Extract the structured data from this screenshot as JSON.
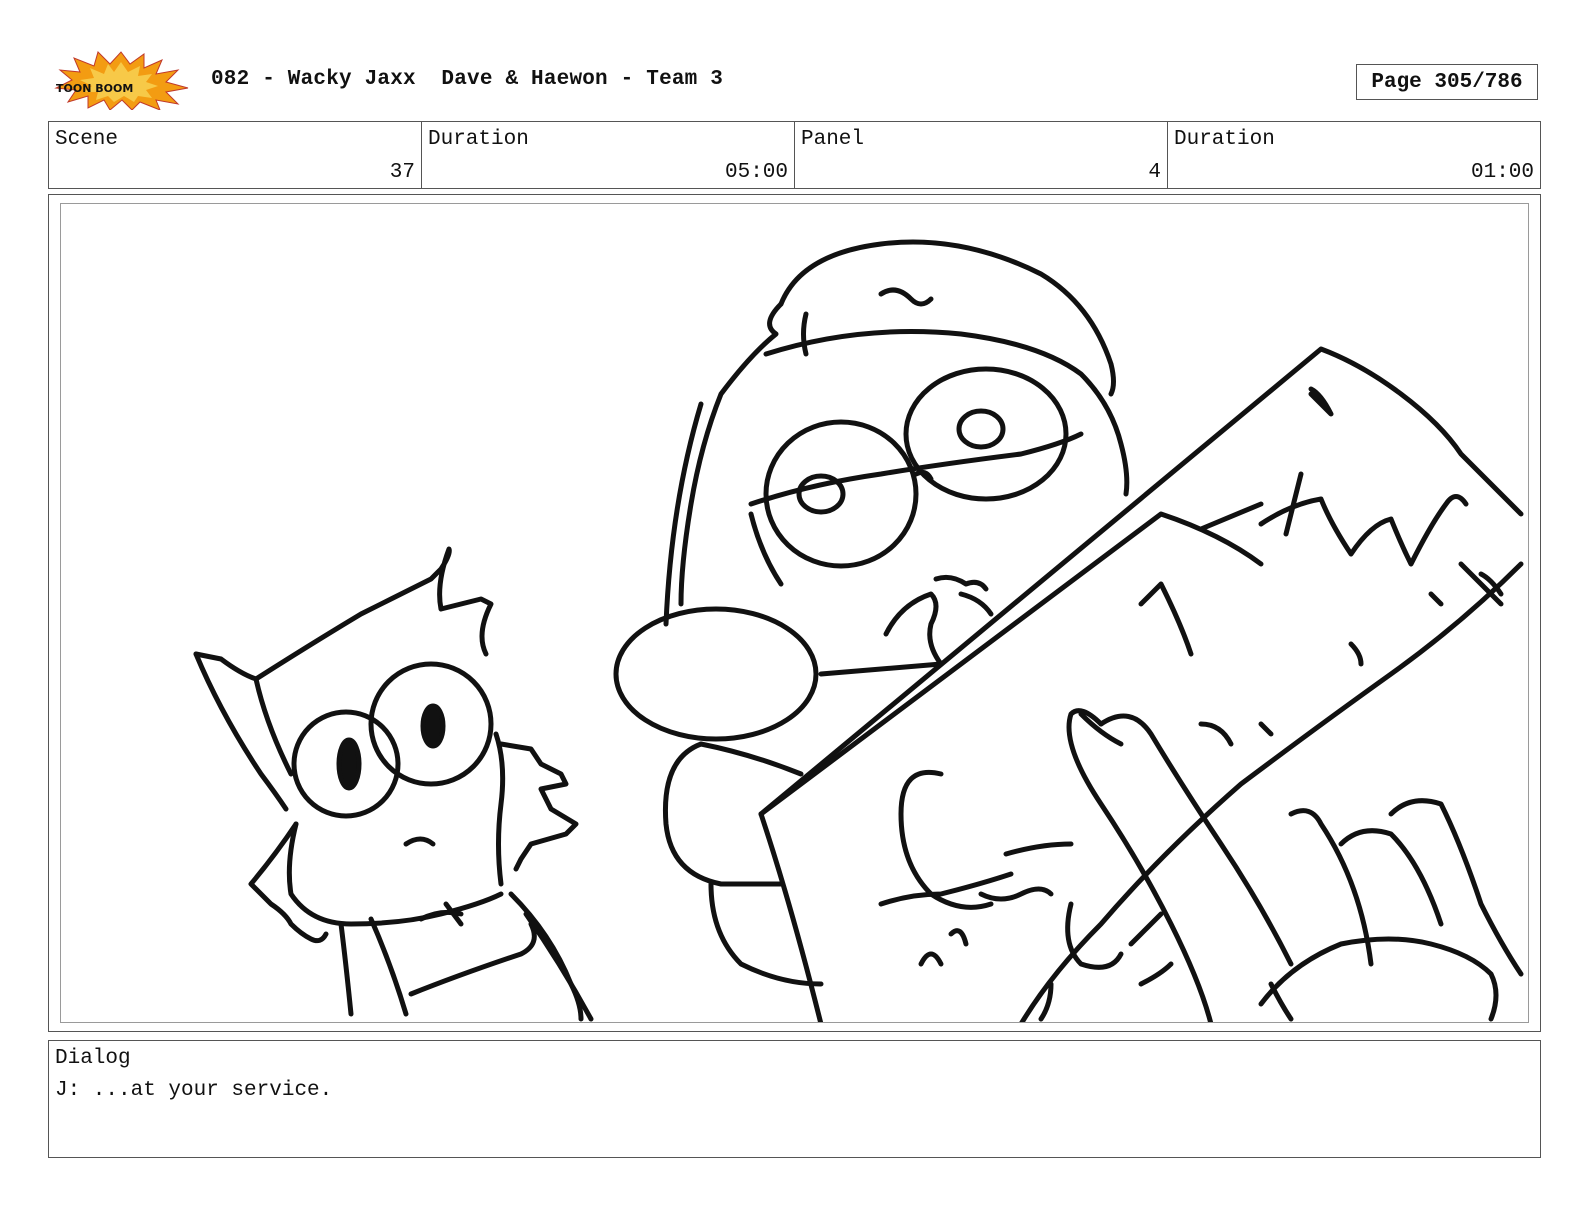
{
  "header": {
    "logo_text": "TOON BOOM",
    "title": "082 - Wacky Jaxx  Dave & Haewon - Team 3",
    "page": "Page 305/786"
  },
  "info": {
    "scene_label": "Scene",
    "scene_value": "37",
    "scene_duration_label": "Duration",
    "scene_duration_value": "05:00",
    "panel_label": "Panel",
    "panel_value": "4",
    "panel_duration_label": "Duration",
    "panel_duration_value": "01:00"
  },
  "panel": {
    "drawing": "storyboard-sketch"
  },
  "dialog": {
    "label": "Dialog",
    "text": "J: ...at your service."
  },
  "colors": {
    "logo_burst": "#f39c12",
    "logo_burst_inner": "#f7c948",
    "logo_text": "#111111",
    "border": "#555555",
    "ink": "#111111"
  }
}
